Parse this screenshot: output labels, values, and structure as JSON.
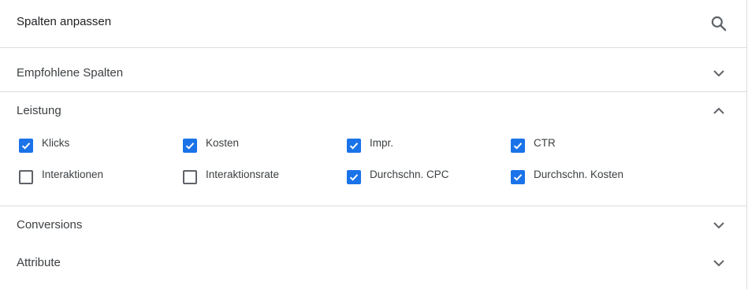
{
  "header": {
    "title": "Spalten anpassen",
    "search_icon": "search-icon"
  },
  "sections": [
    {
      "title": "Empfohlene Spalten",
      "expanded": false
    },
    {
      "title": "Leistung",
      "expanded": true
    },
    {
      "title": "Conversions",
      "expanded": false
    },
    {
      "title": "Attribute",
      "expanded": false
    }
  ],
  "leistung_options": [
    {
      "label": "Klicks",
      "checked": true
    },
    {
      "label": "Kosten",
      "checked": true
    },
    {
      "label": "Impr.",
      "checked": true
    },
    {
      "label": "CTR",
      "checked": true
    },
    {
      "label": "Interaktionen",
      "checked": false
    },
    {
      "label": "Interaktionsrate",
      "checked": false
    },
    {
      "label": "Durchschn. CPC",
      "checked": true
    },
    {
      "label": "Durchschn. Kosten",
      "checked": true
    }
  ],
  "colors": {
    "checkbox_checked": "#1a73e8",
    "checkbox_unchecked_border": "#5f6368",
    "divider": "#dadce0"
  }
}
